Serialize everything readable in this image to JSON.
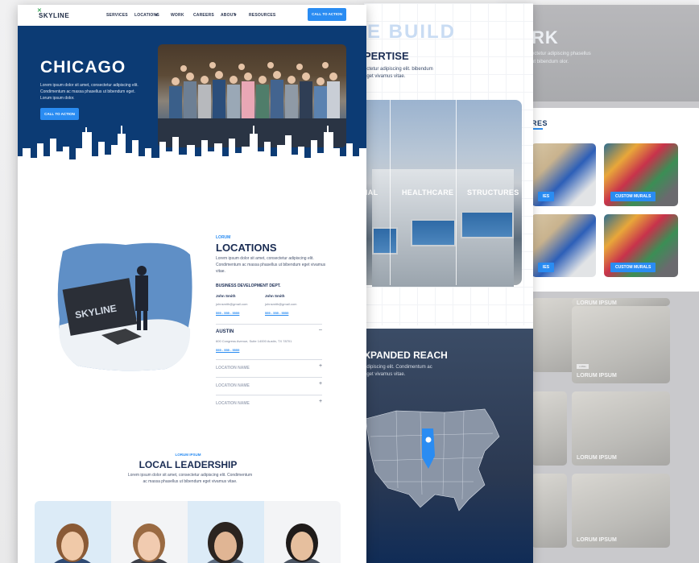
{
  "colors": {
    "navy": "#0c3b74",
    "accent": "#2a8cf2",
    "heading": "#1a2c53"
  },
  "back_panel": {
    "hero_title": "RK",
    "hero_text": "ectetur adipiscing phasellus ut bibendum olor.",
    "category": "RES",
    "tiles": [
      {
        "badge": "IES"
      },
      {
        "badge": "CUSTOM MURALS"
      },
      {
        "badge": "IES"
      },
      {
        "badge": "CUSTOM MURALS"
      }
    ],
    "gallery": [
      {
        "label": "LORUM IPSUM"
      },
      {
        "label": "LORUM IPSUM"
      },
      {
        "label": "LORUM IPSUM"
      },
      {
        "label": "LORUM IPSUM"
      },
      {
        "label": "LORUM IPSUM"
      },
      {
        "label": "LORUM IPSUM"
      }
    ],
    "chip": "LABEL"
  },
  "middle_panel": {
    "build_title": "E BUILD",
    "expertise_title": "PERTISE",
    "expertise_text": "ectetur adipiscing elit. bibendum eget vivamus vitae.",
    "labels": [
      "IAL",
      "HEALTHCARE",
      "STRUCTURES"
    ],
    "reach_title": "XPANDED REACH",
    "reach_text": "adipiscing elit. Condimentum ac eget vivamus vitae."
  },
  "front_panel": {
    "logo": "SKYLINE",
    "nav": [
      "SERVICES",
      "LOCATIONS",
      "WORK",
      "CAREERS",
      "ABOUT",
      "RESOURCES"
    ],
    "nav_cta": "CALL TO ACTION",
    "hero": {
      "title": "CHICAGO",
      "text": "Lorem ipsum dolor sit amet, consectetur adipiscing elit. Condimentum ac massa phasellus ut bibendum eget. Lorum ipsum dolor.",
      "cta": "CALL TO ACTION"
    },
    "locations": {
      "eyebrow": "LORUM",
      "title": "LOCATIONS",
      "text": "Lorem ipsum dolor sit amet, consectetur adipiscing elit. Condimentum ac massa phasellus ut bibendum eget vivamus vitae.",
      "bd_heading": "BUSINESS DEVELOPMENT DEPT.",
      "contacts": [
        {
          "name": "John Smith",
          "email": "johnsmith@gmail.com",
          "phone": "555 - 555 - 5555"
        },
        {
          "name": "John Smith",
          "email": "johnsmith@gmail.com",
          "phone": "555 - 555 - 5555"
        }
      ],
      "austin": {
        "name": "AUSTIN",
        "address": "600 Congress Avenue, Suite 14000 Austin, TX 78701",
        "phone": "555 - 555 - 5555"
      },
      "collapsed": [
        "LOCATION NAME",
        "LOCATION NAME",
        "LOCATION NAME"
      ]
    },
    "flag_text": "SKYLINE",
    "leadership": {
      "eyebrow": "LORUM IPSUM",
      "title": "LOCAL LEADERSHIP",
      "text": "Lorem ipsum dolor sit amet, consectetur adipiscing elit. Condimentum ac massa phasellus ut bibendum eget vivamus vitae."
    }
  }
}
